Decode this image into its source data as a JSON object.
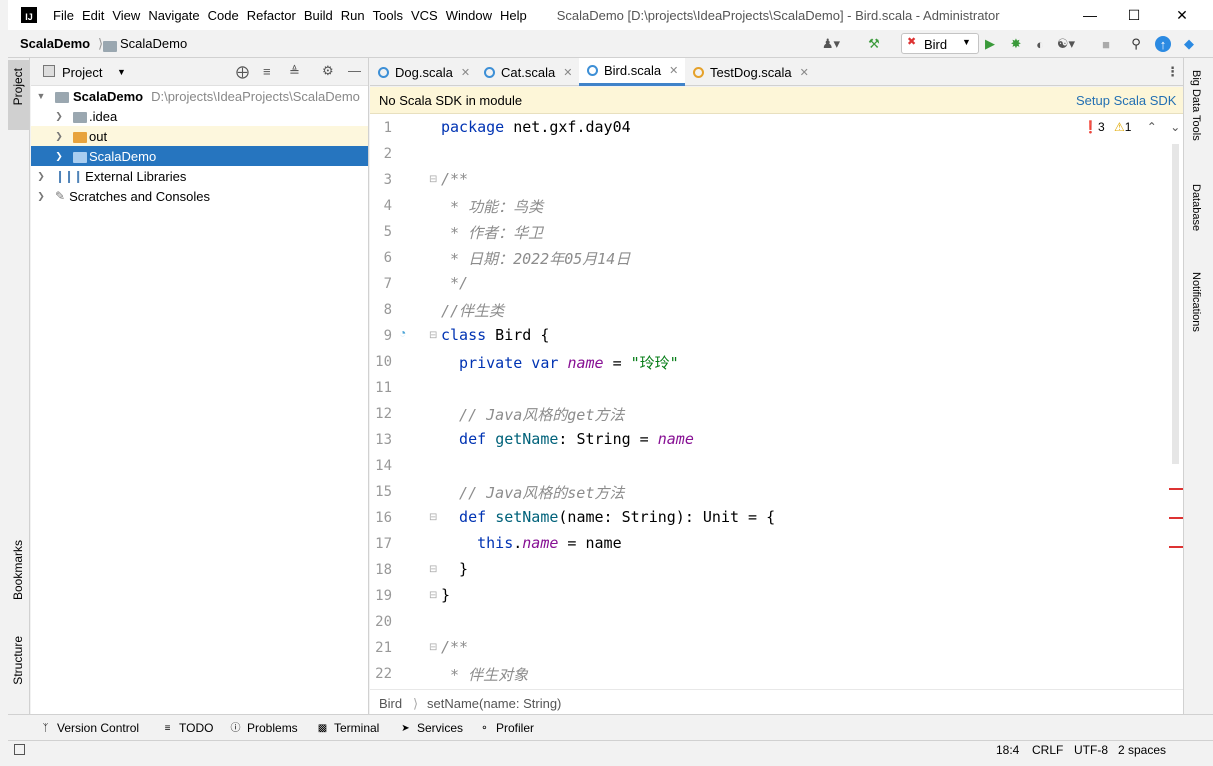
{
  "window": {
    "title": "ScalaDemo [D:\\projects\\IdeaProjects\\ScalaDemo] - Bird.scala - Administrator",
    "logo": "IJ",
    "menus": [
      "File",
      "Edit",
      "View",
      "Navigate",
      "Code",
      "Refactor",
      "Build",
      "Run",
      "Tools",
      "VCS",
      "Window",
      "Help"
    ]
  },
  "navbar": {
    "project": "ScalaDemo",
    "module": "ScalaDemo",
    "run_config": "Bird"
  },
  "project_panel": {
    "title": "Project",
    "tree": [
      {
        "label": "ScalaDemo",
        "path": "D:\\projects\\IdeaProjects\\ScalaDemo",
        "icon": "folder-icon"
      },
      {
        "label": ".idea",
        "icon": "folder-icon"
      },
      {
        "label": "out",
        "icon": "folder-orange-icon"
      },
      {
        "label": "ScalaDemo",
        "icon": "folder-blue-icon"
      },
      {
        "label": "External Libraries",
        "icon": "library-icon"
      },
      {
        "label": "Scratches and Consoles",
        "icon": "scratches-icon"
      }
    ]
  },
  "left_stripe": {
    "project": "Project",
    "bookmarks": "Bookmarks",
    "structure": "Structure"
  },
  "right_stripe": {
    "big_data": "Big Data Tools",
    "database": "Database",
    "notifications": "Notifications"
  },
  "tabs": [
    {
      "label": "Dog.scala",
      "active": false
    },
    {
      "label": "Cat.scala",
      "active": false
    },
    {
      "label": "Bird.scala",
      "active": true
    },
    {
      "label": "TestDog.scala",
      "active": false
    }
  ],
  "banner": {
    "message": "No Scala SDK in module",
    "action": "Setup Scala SDK"
  },
  "inspections": {
    "errors": "3",
    "warnings": "1"
  },
  "editor": {
    "line_numbers": [
      "1",
      "2",
      "3",
      "4",
      "5",
      "6",
      "7",
      "8",
      "9",
      "10",
      "11",
      "12",
      "13",
      "14",
      "15",
      "16",
      "17",
      "18",
      "19",
      "20",
      "21",
      "22"
    ],
    "lines": {
      "l1a": "package",
      "l1b": " net.gxf.day04",
      "l3": "/**",
      "l4": " * 功能：鸟类",
      "l5": " * 作者：华卫",
      "l6": " * 日期：2022年05月14日",
      "l7": " */",
      "l8": "//伴生类",
      "l9a": "class",
      "l9b": " Bird {",
      "l10a": "  private var ",
      "l10b": "name",
      "l10c": " = ",
      "l10d": "\"玲玲\"",
      "l12": "  // Java风格的get方法",
      "l13a": "  def ",
      "l13b": "getName",
      "l13c": ": String = ",
      "l13d": "name",
      "l15": "  // Java风格的set方法",
      "l16a": "  def ",
      "l16b": "setName",
      "l16c": "(name: String): Unit = {",
      "l17a": "    this",
      "l17b": ".",
      "l17c": "name",
      "l17d": " = name",
      "l18": "  }",
      "l19": "}",
      "l21": "/**",
      "l22": " * 伴生对象"
    }
  },
  "breadcrumbs": {
    "class": "Bird",
    "method": "setName(name: String)"
  },
  "bottom_tools": [
    "Version Control",
    "TODO",
    "Problems",
    "Terminal",
    "Services",
    "Profiler"
  ],
  "status": {
    "position": "18:4",
    "line_sep": "CRLF",
    "encoding": "UTF-8",
    "indent": "2 spaces"
  }
}
